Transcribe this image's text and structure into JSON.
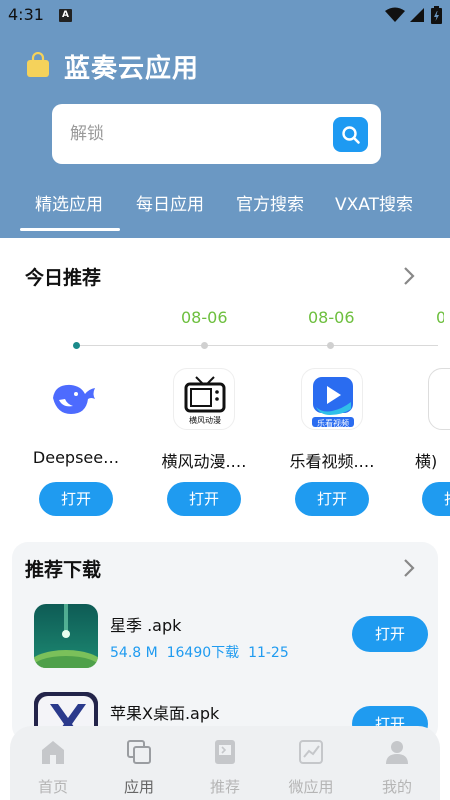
{
  "status_bar": {
    "time": "4:31",
    "notif_glyph": "A"
  },
  "app": {
    "title": "蓝奏云应用"
  },
  "search": {
    "placeholder": "解锁"
  },
  "tabs": [
    {
      "label": "精选应用",
      "active": true
    },
    {
      "label": "每日应用",
      "active": false
    },
    {
      "label": "官方搜索",
      "active": false
    },
    {
      "label": "VXAT搜索",
      "active": false
    }
  ],
  "today": {
    "title": "今日推荐",
    "dates": [
      "08-06",
      "08-06"
    ],
    "apps": [
      {
        "name": "Deepsee…",
        "icon": "whale-icon",
        "open_label": "打开"
      },
      {
        "name": "横风动漫.…",
        "icon": "tv-icon",
        "icon_caption": "横风动漫",
        "open_label": "打开"
      },
      {
        "name": "乐看视频.…",
        "icon": "play-icon",
        "icon_caption": "乐看视频",
        "open_label": "打开"
      },
      {
        "name": "横)",
        "icon": "partial-icon",
        "open_label": "打开"
      }
    ]
  },
  "downloads": {
    "title": "推荐下载",
    "items": [
      {
        "name": "星季 .apk",
        "size": "54.8 M",
        "downloads": "16490下载",
        "date": "11-25",
        "open_label": "打开",
        "icon": "planet-icon"
      },
      {
        "name": "苹果X桌面.apk",
        "open_label": "打开",
        "icon": "x-logo-icon"
      }
    ]
  },
  "bottom_nav": [
    {
      "label": "首页",
      "icon": "home-icon",
      "active": false
    },
    {
      "label": "应用",
      "icon": "apps-icon",
      "active": true
    },
    {
      "label": "推荐",
      "icon": "recommend-icon",
      "active": false
    },
    {
      "label": "微应用",
      "icon": "chart-icon",
      "active": false
    },
    {
      "label": "我的",
      "icon": "profile-icon",
      "active": false
    }
  ],
  "colors": {
    "header": "#6b98c3",
    "accent": "#1f9bf0",
    "date_green": "#6dbf3e"
  }
}
